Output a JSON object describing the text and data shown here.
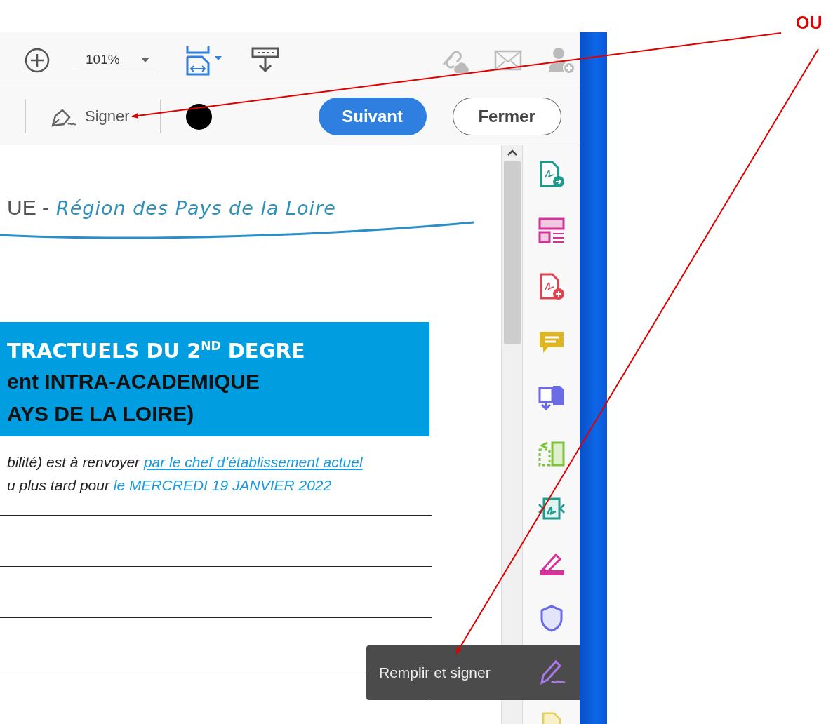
{
  "toolbar": {
    "zoom": "101%"
  },
  "sign_bar": {
    "sign_label": "Signer",
    "next_button": "Suivant",
    "close_button": "Fermer"
  },
  "document": {
    "header_prefix": "UE -",
    "header_region": "Région des Pays de la Loire",
    "banner_lines": [
      "TRACTUELS DU 2$^{ND}$ DEGRE",
      "ent INTRA-ACADEMIQUE",
      "AYS DE LA LOIRE)"
    ],
    "note_lines": [
      {
        "text": "bilité) est à renvoyer ",
        "emphasis": "par le chef d’établissement actuel",
        "link": true
      },
      {
        "text": "u plus tard pour ",
        "emphasis": "le MERCREDI 19 JANVIER 2022",
        "link": false
      }
    ]
  },
  "tools_pane": {
    "tooltip": "Remplir et signer"
  },
  "annotation": {
    "label": "OU"
  }
}
